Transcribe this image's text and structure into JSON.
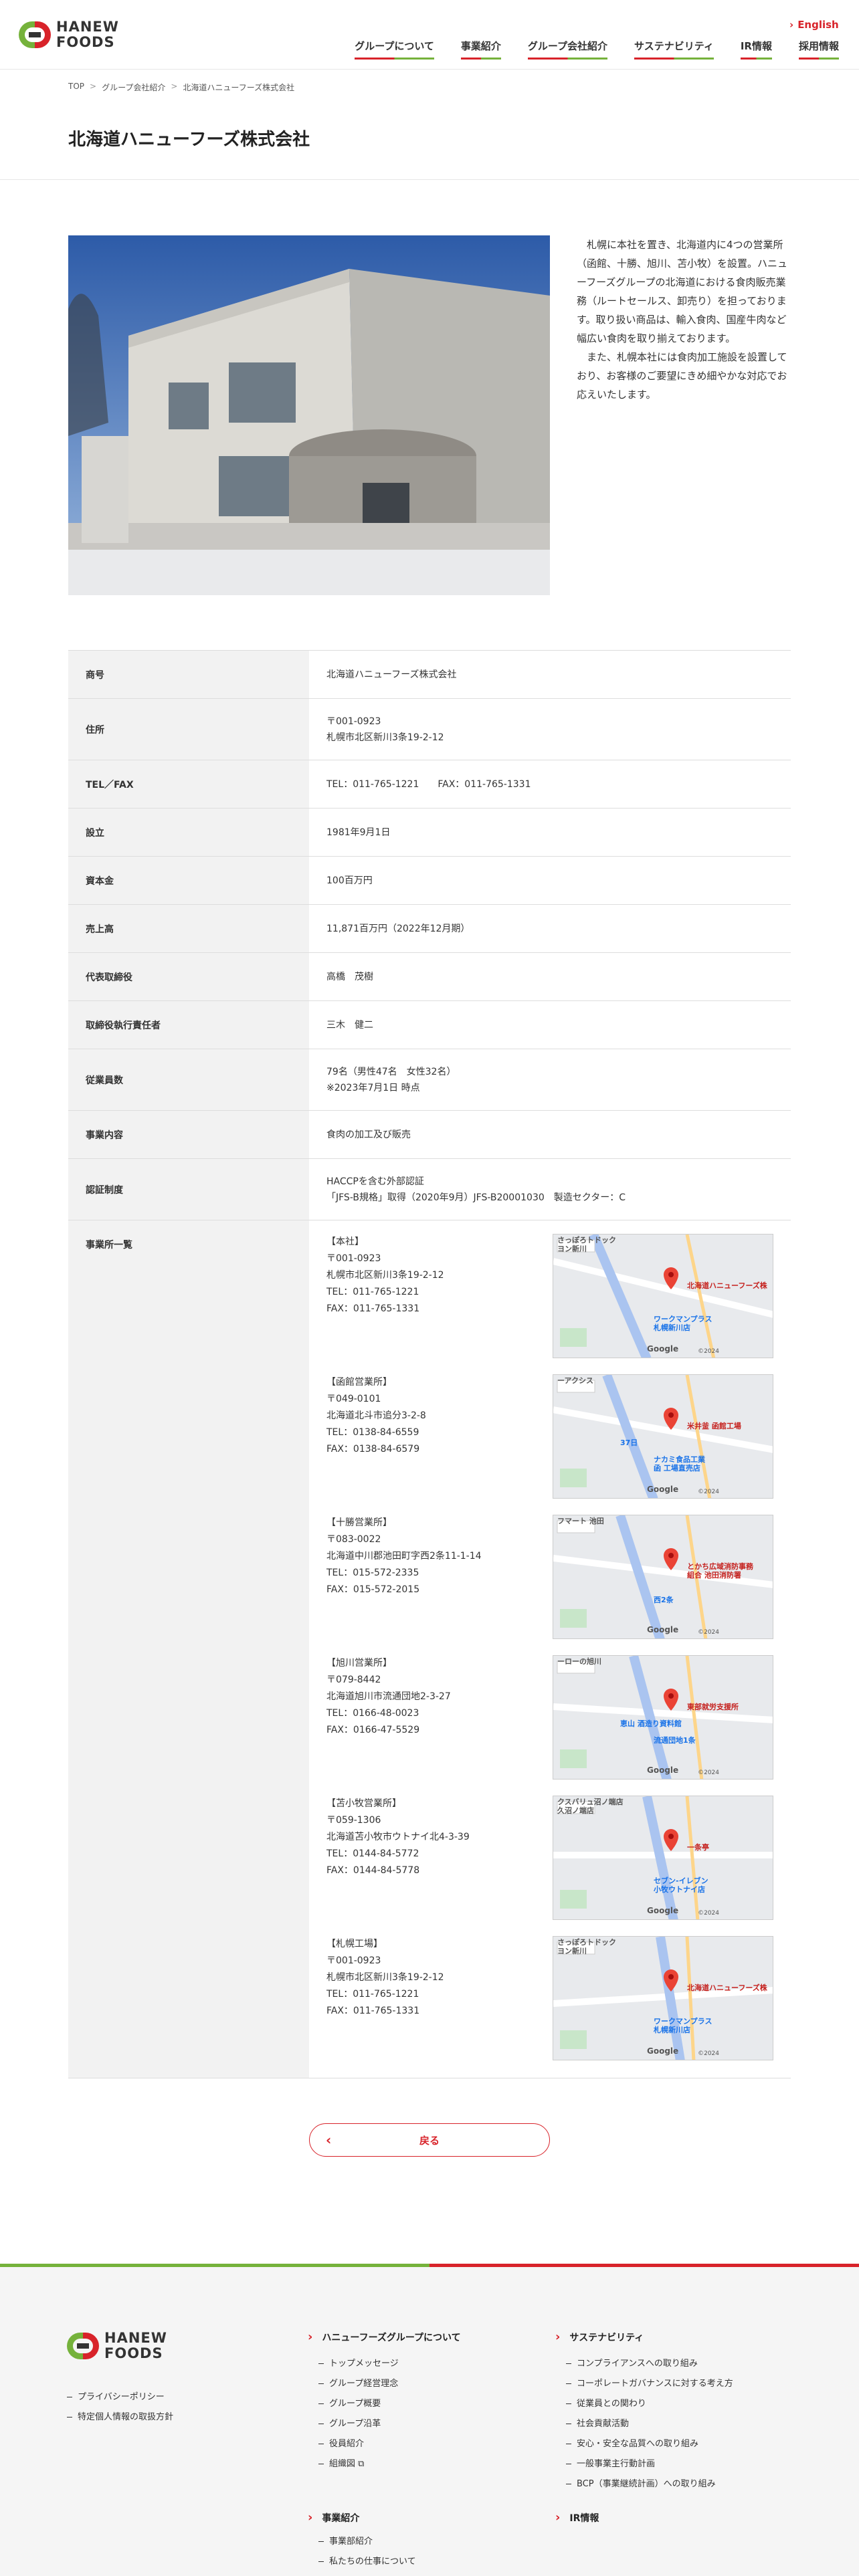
{
  "header": {
    "logo_line1": "HANEW",
    "logo_line2": "FOODS",
    "english": "English",
    "nav": [
      "グループについて",
      "事業紹介",
      "グループ会社紹介",
      "サステナビリティ",
      "IR情報",
      "採用情報"
    ]
  },
  "breadcrumb": [
    "TOP",
    "グループ会社紹介",
    "北海道ハニューフーズ株式会社"
  ],
  "page_title": "北海道ハニューフーズ株式会社",
  "intro": {
    "paragraphs": [
      "札幌に本社を置き、北海道内に4つの営業所（函館、十勝、旭川、苫小牧）を設置。ハニューフーズグループの北海道における食肉販売業務（ルートセールス、卸売り）を担っております。取り扱い商品は、輸入食肉、国産牛肉など幅広い食肉を取り揃えております。",
      "また、札幌本社には食肉加工施設を設置しており、お客様のご要望にきめ細やかな対応でお応えいたします。"
    ]
  },
  "table": [
    {
      "label": "商号",
      "value": "北海道ハニューフーズ株式会社"
    },
    {
      "label": "住所",
      "value": "〒001-0923\n札幌市北区新川3条19-2-12"
    },
    {
      "label": "TEL／FAX",
      "value": "TEL：011-765-1221　　FAX：011-765-1331"
    },
    {
      "label": "設立",
      "value": "1981年9月1日"
    },
    {
      "label": "資本金",
      "value": "100百万円"
    },
    {
      "label": "売上高",
      "value": "11,871百万円（2022年12月期）"
    },
    {
      "label": "代表取締役",
      "value": "高橋　茂樹"
    },
    {
      "label": "取締役執行責任者",
      "value": "三木　健二"
    },
    {
      "label": "従業員数",
      "value": "79名（男性47名　女性32名）\n※2023年7月1日 時点"
    },
    {
      "label": "事業内容",
      "value": "食肉の加工及び販売"
    },
    {
      "label": "認証制度",
      "value": "HACCPを含む外部認証\n「JFS-B規格」取得（2020年9月）JFS-B20001030　製造セクター：C"
    }
  ],
  "offices_label": "事業所一覧",
  "offices": [
    {
      "text": "【本社】\n〒001-0923\n札幌市北区新川3条19-2-12\nTEL：011-765-1221\nFAX：011-765-1331",
      "map_labels": [
        "北海道ハニューフーズ株",
        "ワークマンプラス\n札幌新川店",
        "さっぽろトドック\nヨン新川"
      ]
    },
    {
      "text": "【函館営業所】\n〒049-0101\n北海道北斗市追分3-2-8\nTEL：0138-84-6559\nFAX：0138-84-6579",
      "map_labels": [
        "米井釜 函館工場",
        "ナカミ食品工業\n函 工場直売店",
        "ーアクシス",
        "37日"
      ]
    },
    {
      "text": "【十勝営業所】\n〒083-0022\n北海道中川郡池田町字西2条11-1-14\nTEL：015-572-2335\nFAX：015-572-2015",
      "map_labels": [
        "とかち広域消防事務\n組合 池田消防署",
        "西2条",
        "フマート 池田"
      ]
    },
    {
      "text": "【旭川営業所】\n〒079-8442\n北海道旭川市流通団地2-3-27\nTEL：0166-48-0023\nFAX：0166-47-5529",
      "map_labels": [
        "東部就労支援所",
        "流通団地1条",
        "ーローの旭川",
        "恵山 酒造り資料館"
      ]
    },
    {
      "text": "【苫小牧営業所】\n〒059-1306\n北海道苫小牧市ウトナイ北4-3-39\nTEL：0144-84-5772\nFAX：0144-84-5778",
      "map_labels": [
        "一条亭",
        "セブン-イレブン\n小牧ウトナイ店",
        "クスバリュ沼ノ端店\n久沼ノ端店"
      ]
    },
    {
      "text": "【札幌工場】\n〒001-0923\n札幌市北区新川3条19-2-12\nTEL：011-765-1221\nFAX：011-765-1331",
      "map_labels": [
        "北海道ハニューフーズ株",
        "ワークマンプラス\n札幌新川店",
        "さっぽろトドック\nヨン新川"
      ]
    }
  ],
  "map_common": {
    "google": "Google",
    "copyright": "©2024"
  },
  "back_label": "戻る",
  "footer": {
    "left_links": [
      "プライバシーポリシー",
      "特定個人情報の取扱方針"
    ],
    "col1_head": "ハニューフーズグループについて",
    "col1_links": [
      "トップメッセージ",
      "グループ経営理念",
      "グループ概要",
      "グループ沿革",
      "役員紹介",
      "組織図"
    ],
    "col2_head": "サステナビリティ",
    "col2_links": [
      "コンプライアンスへの取り組み",
      "コーポレートガバナンスに対する考え方",
      "従業員との関わり",
      "社会貢献活動",
      "安心・安全な品質への取り組み",
      "一般事業主行動計画",
      "BCP（事業継続計画）への取り組み"
    ],
    "col3_head": "事業紹介",
    "col3_links": [
      "事業部紹介",
      "私たちの仕事について"
    ],
    "col4_head": "IR情報"
  },
  "colors": {
    "red": "#d8232a",
    "green": "#75b23b"
  }
}
